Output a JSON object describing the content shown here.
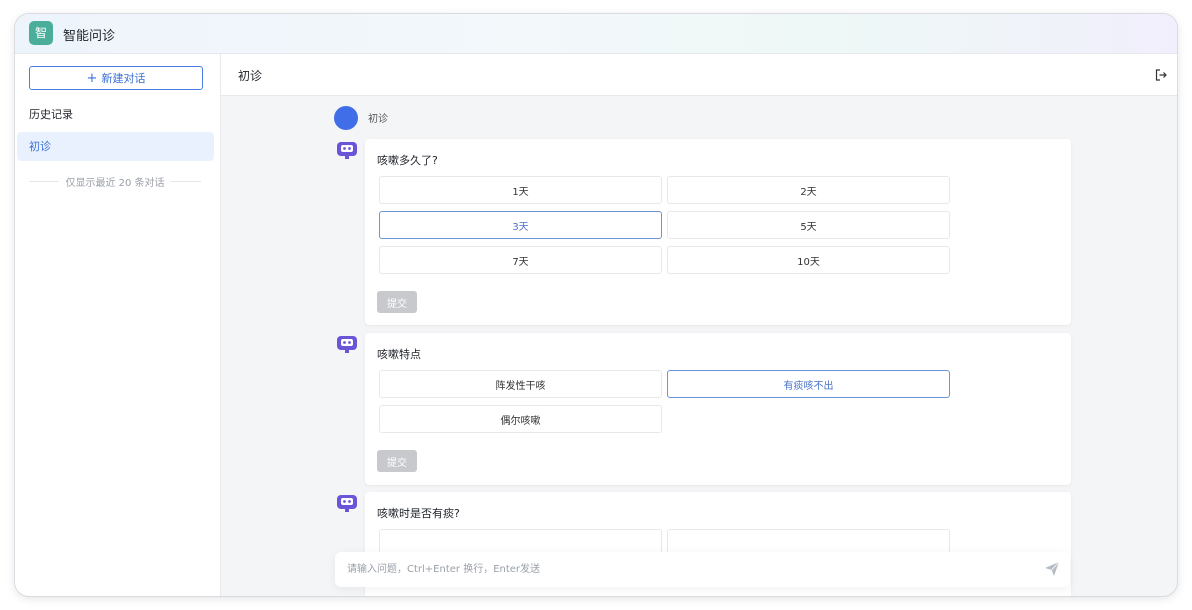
{
  "app": {
    "logo_char": "智",
    "title": "智能问诊"
  },
  "sidebar": {
    "new_chat_label": "新建对话",
    "history_title": "历史记录",
    "history_items": [
      {
        "label": "初诊"
      }
    ],
    "history_note": "仅显示最近 20 条对话"
  },
  "header": {
    "conversation_title": "初诊"
  },
  "chat": {
    "user_message": "初诊",
    "questions": [
      {
        "question": "咳嗽多久了?",
        "options": [
          {
            "label": "1天",
            "selected": false
          },
          {
            "label": "2天",
            "selected": false
          },
          {
            "label": "3天",
            "selected": true
          },
          {
            "label": "5天",
            "selected": false
          },
          {
            "label": "7天",
            "selected": false
          },
          {
            "label": "10天",
            "selected": false
          }
        ],
        "submit_label": "提交"
      },
      {
        "question": "咳嗽特点",
        "options": [
          {
            "label": "阵发性干咳",
            "selected": false
          },
          {
            "label": "有痰咳不出",
            "selected": true
          },
          {
            "label": "偶尔咳嗽",
            "selected": false
          }
        ],
        "submit_label": "提交"
      },
      {
        "question": "咳嗽时是否有痰?",
        "options": [],
        "submit_label": ""
      }
    ]
  },
  "input": {
    "placeholder": "请输入问题，Ctrl+Enter 换行，Enter发送",
    "value": ""
  },
  "colors": {
    "accent": "#3a6fd6",
    "logo": "#4bae9b",
    "bot": "#6a55d8",
    "submit_disabled": "#c8c9cc"
  }
}
